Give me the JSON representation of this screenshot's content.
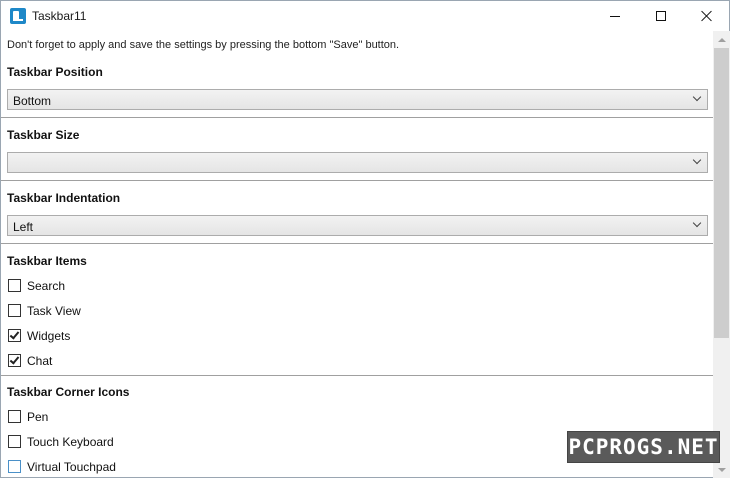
{
  "window": {
    "title": "Taskbar11"
  },
  "notice": "Don't forget to apply and save the settings by pressing the bottom \"Save\" button.",
  "sections": {
    "position": {
      "heading": "Taskbar Position",
      "value": "Bottom"
    },
    "size": {
      "heading": "Taskbar Size",
      "value": ""
    },
    "indentation": {
      "heading": "Taskbar Indentation",
      "value": "Left"
    },
    "items": {
      "heading": "Taskbar Items",
      "options": [
        {
          "label": "Search",
          "checked": false
        },
        {
          "label": "Task View",
          "checked": false
        },
        {
          "label": "Widgets",
          "checked": true
        },
        {
          "label": "Chat",
          "checked": true
        }
      ]
    },
    "corner_icons": {
      "heading": "Taskbar Corner Icons",
      "options": [
        {
          "label": "Pen",
          "checked": false
        },
        {
          "label": "Touch Keyboard",
          "checked": false
        },
        {
          "label": "Virtual Touchpad",
          "checked": false
        }
      ]
    }
  },
  "watermark": "PCPROGS.NET",
  "colors": {
    "accent": "#1e88c8",
    "combo_border": "#acacac",
    "scroll_thumb": "#cdcdcd"
  }
}
